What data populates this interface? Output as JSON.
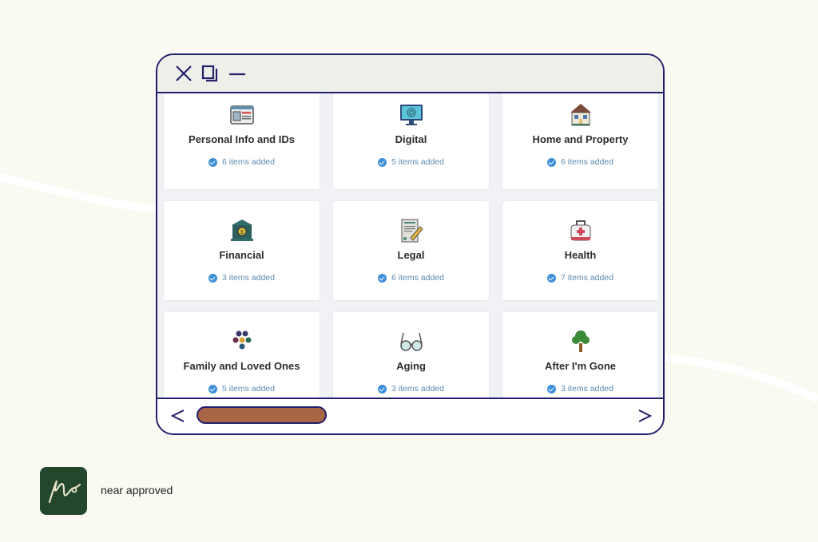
{
  "window": {
    "controls": [
      {
        "name": "close",
        "icon": "close-icon"
      },
      {
        "name": "restore",
        "icon": "restore-icon"
      },
      {
        "name": "minimize",
        "icon": "minimize-icon"
      }
    ]
  },
  "categories": [
    {
      "title": "Personal Info and IDs",
      "status": "6 items added",
      "icon": "id-card-icon"
    },
    {
      "title": "Digital",
      "status": "5 items added",
      "icon": "computer-fingerprint-icon"
    },
    {
      "title": "Home and Property",
      "status": "6 items added",
      "icon": "house-icon"
    },
    {
      "title": "Financial",
      "status": "3 items added",
      "icon": "bank-icon"
    },
    {
      "title": "Legal",
      "status": "6 items added",
      "icon": "document-pen-icon"
    },
    {
      "title": "Health",
      "status": "7 items added",
      "icon": "medical-kit-icon"
    },
    {
      "title": "Family and Loved Ones",
      "status": "5 items added",
      "icon": "family-group-icon"
    },
    {
      "title": "Aging",
      "status": "3 items added",
      "icon": "glasses-icon"
    },
    {
      "title": "After I'm Gone",
      "status": "3 items added",
      "icon": "tree-icon"
    }
  ],
  "scrollbar": {
    "prev_icon": "chevron-left-icon",
    "next_icon": "chevron-right-icon",
    "thumb_color": "#a86646"
  },
  "colors": {
    "frame": "#23206b",
    "background": "#faf9f2",
    "logo_bg": "#22472c",
    "check": "#3d8fd8"
  },
  "brand": {
    "name": "near approved"
  }
}
